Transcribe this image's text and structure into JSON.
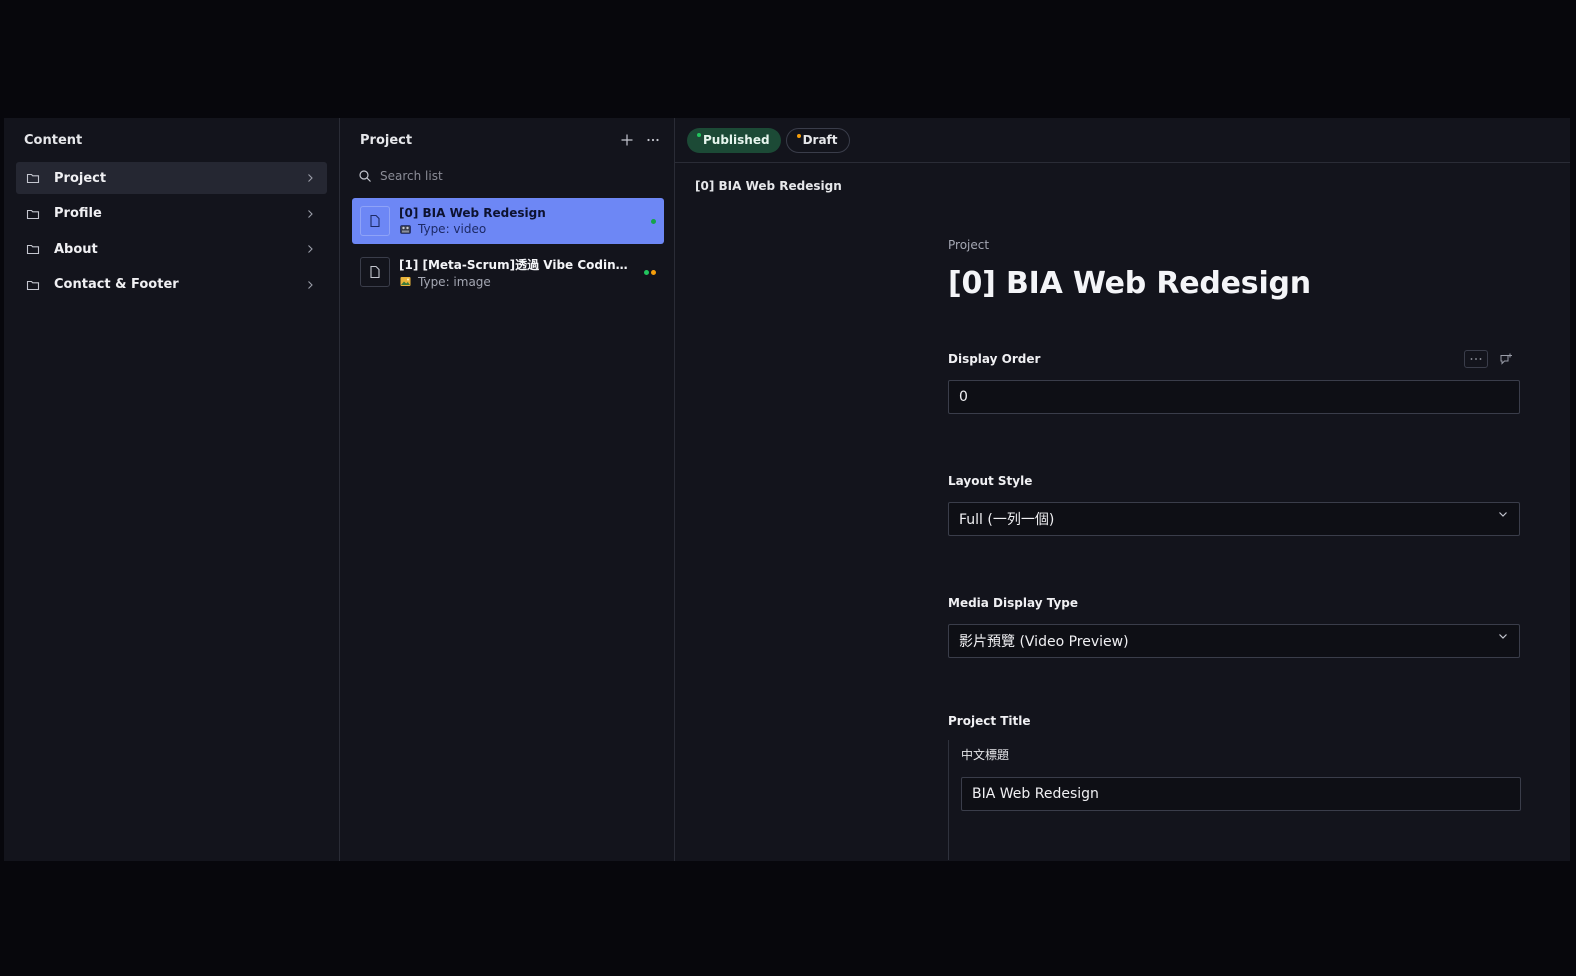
{
  "content_pane": {
    "title": "Content",
    "items": [
      {
        "label": "Project",
        "active": true
      },
      {
        "label": "Profile",
        "active": false
      },
      {
        "label": "About",
        "active": false
      },
      {
        "label": "Contact & Footer",
        "active": false
      }
    ]
  },
  "list_pane": {
    "title": "Project",
    "search_placeholder": "Search list",
    "rows": [
      {
        "title": "[0] BIA Web Redesign",
        "type": "Type: video",
        "selected": true
      },
      {
        "title": "[1] [Meta-Scrum]透過 Vibe Coding 打造...",
        "type": "Type: image",
        "selected": false
      }
    ]
  },
  "doc_pane": {
    "status": {
      "published": "Published",
      "draft": "Draft"
    },
    "breadcrumb": "[0] BIA Web Redesign",
    "type_label": "Project",
    "title": "[0] BIA Web Redesign",
    "fields": {
      "display_order": {
        "label": "Display Order",
        "value": "0"
      },
      "layout_style": {
        "label": "Layout Style",
        "value": "Full (一列一個)"
      },
      "media_display_type": {
        "label": "Media Display Type",
        "value": "影片預覽 (Video Preview)"
      },
      "project_title": {
        "label": "Project Title",
        "sub_label": "中文標題",
        "value": "BIA Web Redesign"
      }
    }
  },
  "colors": {
    "selected_row": "#6d87f5",
    "published_green": "#22c55e",
    "draft_orange": "#f59e0b",
    "published_chip_bg": "#1c4a36"
  },
  "icons": {
    "nav": "folder-icon",
    "chevron": "chevron-right-icon",
    "add": "plus-icon",
    "more": "ellipsis-icon",
    "search": "search-icon",
    "document": "document-icon",
    "video_type": "film-icon",
    "image_type": "image-icon",
    "comment": "comment-add-icon",
    "caret": "chevron-down-icon"
  }
}
